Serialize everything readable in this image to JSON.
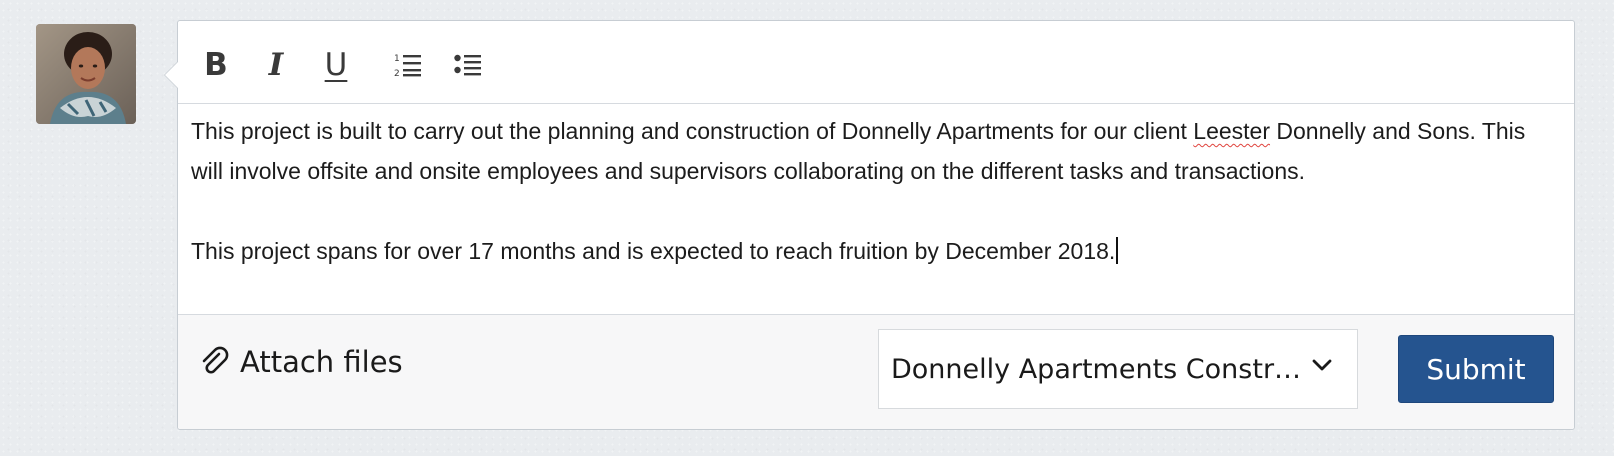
{
  "avatar": {
    "icon": "user-avatar-photo"
  },
  "toolbar": {
    "bold": "B",
    "italic": "I",
    "underline": "U",
    "ordered_list_icon": "ordered-list-icon",
    "bulleted_list_icon": "bulleted-list-icon"
  },
  "editor": {
    "paragraph1_before": "This project is built to carry out the planning and construction of Donnelly Apartments for our client ",
    "misspelled_word": "Leester",
    "paragraph1_after": " Donnelly and Sons. This will involve offsite and onsite employees and supervisors collaborating on the different tasks and transactions.",
    "paragraph2": "This project spans for over 17 months and is expected to reach fruition by December 2018."
  },
  "footer": {
    "attach_label": "Attach files",
    "attach_icon": "paperclip-icon",
    "project_select_value": "Donnelly Apartments Constr…",
    "submit_label": "Submit"
  },
  "colors": {
    "submit_background": "#25548f",
    "spellcheck_underline": "#e0443e",
    "page_background": "#e9ecef"
  }
}
